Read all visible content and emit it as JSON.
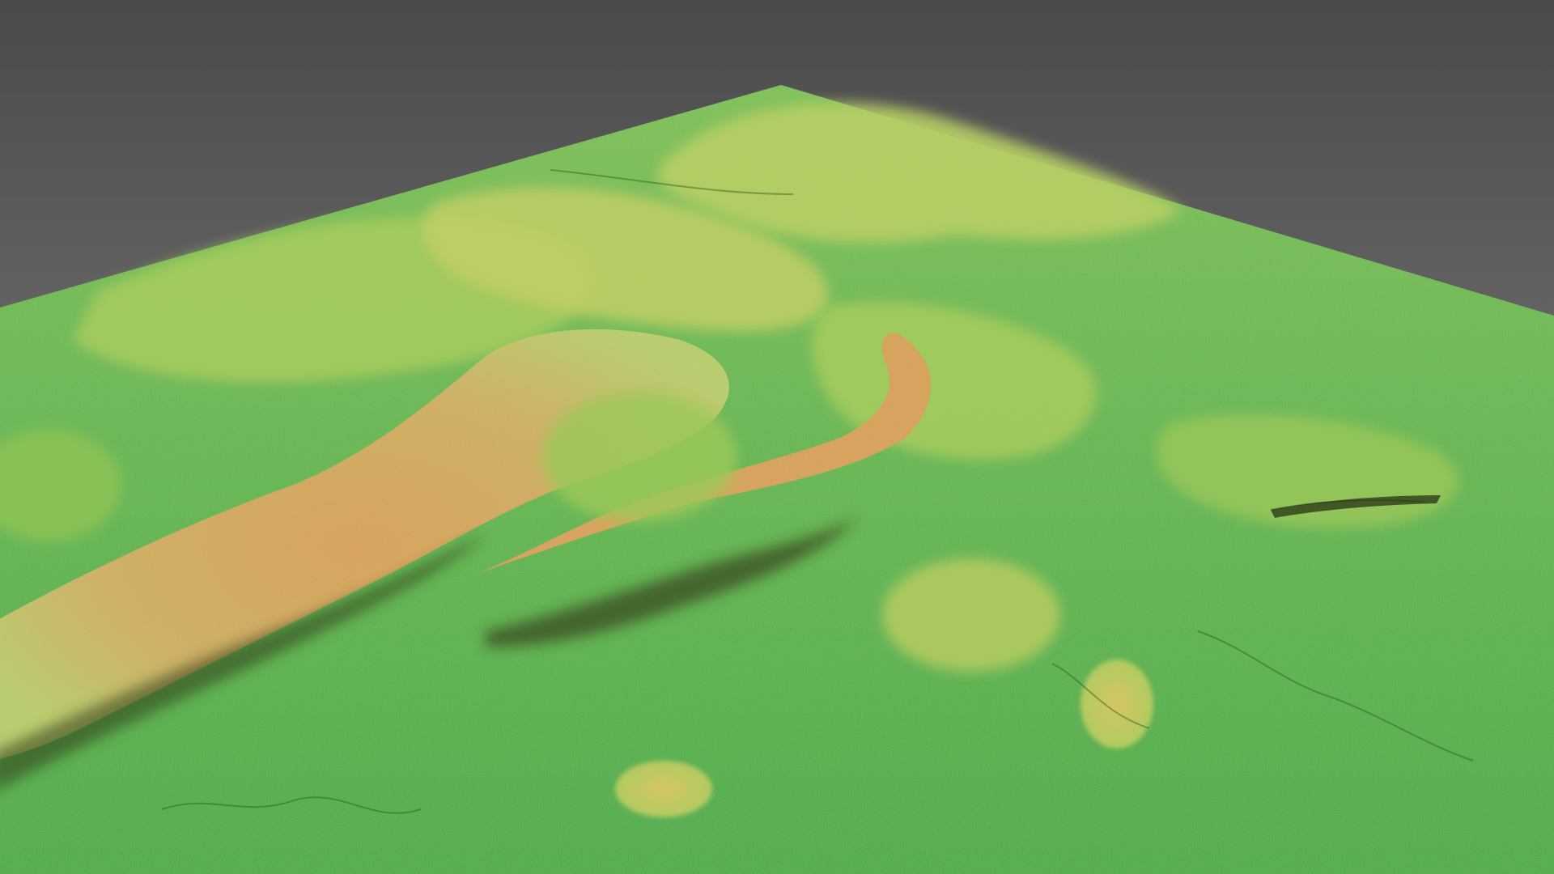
{
  "scene": {
    "subject": "3d-terrain-elevation-model",
    "background_top": "#4a4a4a",
    "background_bottom": "#8e8e8e",
    "palette": {
      "low": "#3fae3c",
      "mid_low": "#7cc24e",
      "mid": "#b9cf66",
      "mid_high": "#d6c567",
      "high": "#d9a24f",
      "shadow": "#3b2a12"
    }
  }
}
